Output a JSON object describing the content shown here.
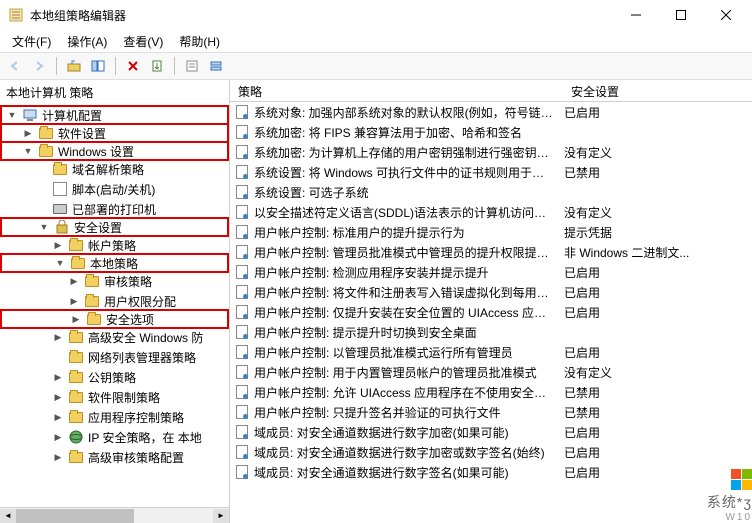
{
  "window": {
    "title": "本地组策略编辑器"
  },
  "menubar": {
    "file": "文件(F)",
    "action": "操作(A)",
    "view": "查看(V)",
    "help": "帮助(H)"
  },
  "left_header": "本地计算机 策略",
  "tree": [
    {
      "level": 0,
      "toggle": "▼",
      "icon": "computer",
      "label": "计算机配置",
      "hl": true
    },
    {
      "level": 1,
      "toggle": "▶",
      "icon": "folder",
      "label": "软件设置",
      "hl": true
    },
    {
      "level": 1,
      "toggle": "▼",
      "icon": "folder",
      "label": "Windows 设置",
      "hl": true
    },
    {
      "level": 2,
      "toggle": "",
      "icon": "folder",
      "label": "域名解析策略"
    },
    {
      "level": 2,
      "toggle": "",
      "icon": "script",
      "label": "脚本(启动/关机)"
    },
    {
      "level": 2,
      "toggle": "",
      "icon": "printer",
      "label": "已部署的打印机"
    },
    {
      "level": 2,
      "toggle": "▼",
      "icon": "security",
      "label": "安全设置",
      "hl": true
    },
    {
      "level": 3,
      "toggle": "▶",
      "icon": "folder",
      "label": "帐户策略"
    },
    {
      "level": 3,
      "toggle": "▼",
      "icon": "folder",
      "label": "本地策略",
      "hl": true
    },
    {
      "level": 4,
      "toggle": "▶",
      "icon": "folder",
      "label": "审核策略"
    },
    {
      "level": 4,
      "toggle": "▶",
      "icon": "folder",
      "label": "用户权限分配"
    },
    {
      "level": 4,
      "toggle": "▶",
      "icon": "folder",
      "label": "安全选项",
      "hl": true
    },
    {
      "level": 3,
      "toggle": "▶",
      "icon": "folder",
      "label": "高级安全 Windows 防"
    },
    {
      "level": 3,
      "toggle": "",
      "icon": "folder",
      "label": "网络列表管理器策略"
    },
    {
      "level": 3,
      "toggle": "▶",
      "icon": "folder",
      "label": "公钥策略"
    },
    {
      "level": 3,
      "toggle": "▶",
      "icon": "folder",
      "label": "软件限制策略"
    },
    {
      "level": 3,
      "toggle": "▶",
      "icon": "folder",
      "label": "应用程序控制策略"
    },
    {
      "level": 3,
      "toggle": "▶",
      "icon": "ipsec",
      "label": "IP 安全策略，在 本地"
    },
    {
      "level": 3,
      "toggle": "▶",
      "icon": "folder",
      "label": "高级审核策略配置"
    }
  ],
  "columns": {
    "c1": "策略",
    "c2": "安全设置"
  },
  "policies": [
    {
      "name": "系统对象: 加强内部系统对象的默认权限(例如，符号链接)",
      "status": "已启用"
    },
    {
      "name": "系统加密: 将 FIPS 兼容算法用于加密、哈希和签名",
      "status": ""
    },
    {
      "name": "系统加密: 为计算机上存储的用户密钥强制进行强密钥保护",
      "status": "没有定义"
    },
    {
      "name": "系统设置: 将 Windows 可执行文件中的证书规则用于软件...",
      "status": "已禁用"
    },
    {
      "name": "系统设置: 可选子系统",
      "status": ""
    },
    {
      "name": "以安全描述符定义语言(SDDL)语法表示的计算机访问限制",
      "status": "没有定义"
    },
    {
      "name": "用户帐户控制: 标准用户的提升提示行为",
      "status": "提示凭据"
    },
    {
      "name": "用户帐户控制: 管理员批准模式中管理员的提升权限提示的...",
      "status": "非 Windows 二进制文..."
    },
    {
      "name": "用户帐户控制: 检测应用程序安装并提示提升",
      "status": "已启用"
    },
    {
      "name": "用户帐户控制: 将文件和注册表写入错误虚拟化到每用户位置",
      "status": "已启用"
    },
    {
      "name": "用户帐户控制: 仅提升安装在安全位置的 UIAccess 应用程序",
      "status": "已启用"
    },
    {
      "name": "用户帐户控制: 提示提升时切换到安全桌面",
      "status": ""
    },
    {
      "name": "用户帐户控制: 以管理员批准模式运行所有管理员",
      "status": "已启用"
    },
    {
      "name": "用户帐户控制: 用于内置管理员帐户的管理员批准模式",
      "status": "没有定义"
    },
    {
      "name": "用户帐户控制: 允许 UIAccess 应用程序在不使用安全桌面...",
      "status": "已禁用"
    },
    {
      "name": "用户帐户控制: 只提升签名并验证的可执行文件",
      "status": "已禁用"
    },
    {
      "name": "域成员: 对安全通道数据进行数字加密(如果可能)",
      "status": "已启用"
    },
    {
      "name": "域成员: 对安全通道数据进行数字加密或数字签名(始终)",
      "status": "已启用"
    },
    {
      "name": "域成员: 对安全通道数据进行数字签名(如果可能)",
      "status": "已启用"
    }
  ],
  "watermark": {
    "main": "系统*ʒ",
    "sub": "W10"
  }
}
